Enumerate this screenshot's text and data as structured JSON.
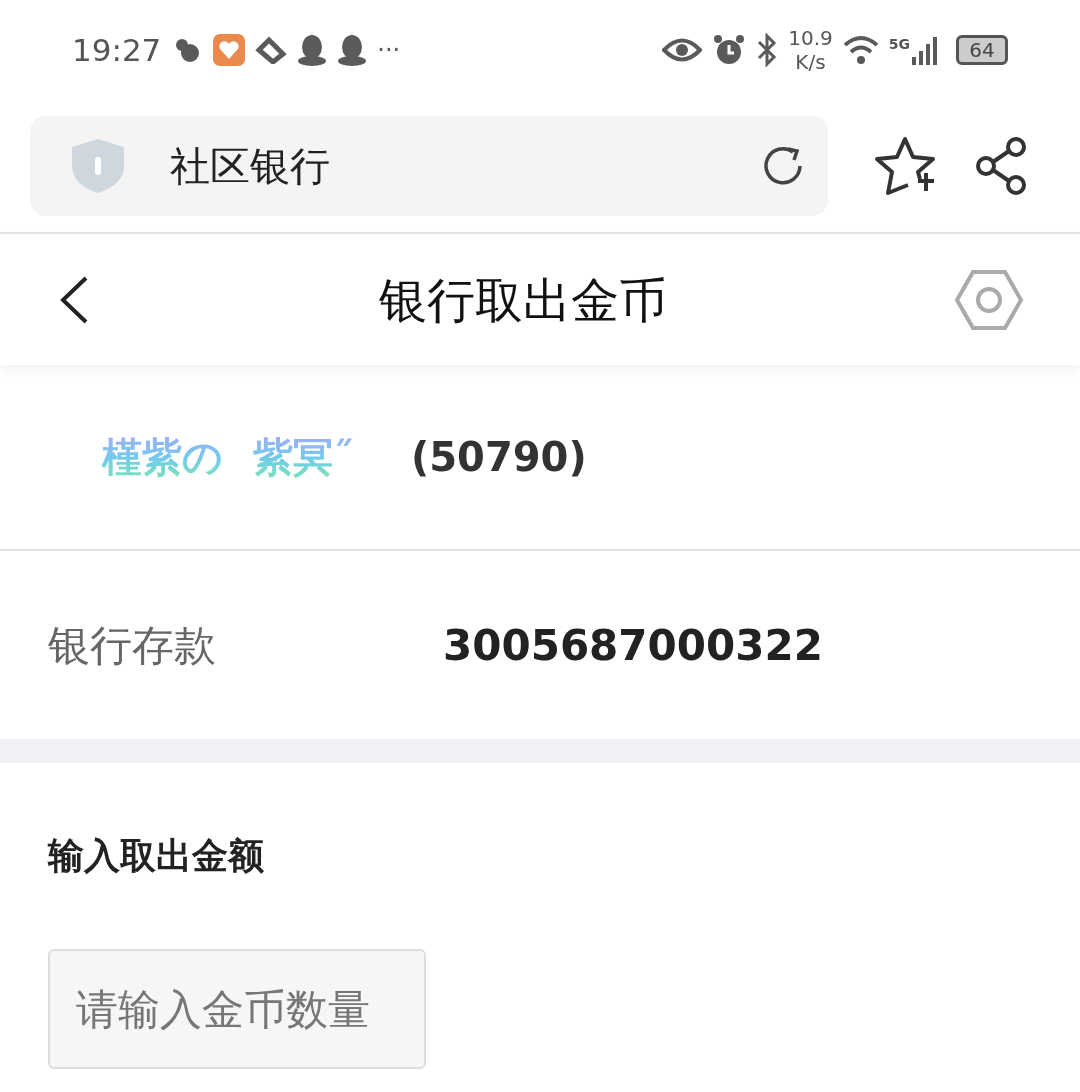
{
  "status_bar": {
    "time": "19:27",
    "more": "···",
    "net_speed": [
      "10.9",
      "K/s"
    ],
    "network": "5G",
    "battery": "64"
  },
  "address_bar": {
    "title": "社区银行"
  },
  "header": {
    "title": "银行取出金币"
  },
  "user": {
    "name": [
      "槿紫の",
      "紫冥˝"
    ],
    "id": "(50790)"
  },
  "deposit": {
    "label": "银行存款",
    "value": "3005687000322"
  },
  "withdraw": {
    "label": "输入取出金额",
    "placeholder": "请输入金币数量"
  }
}
